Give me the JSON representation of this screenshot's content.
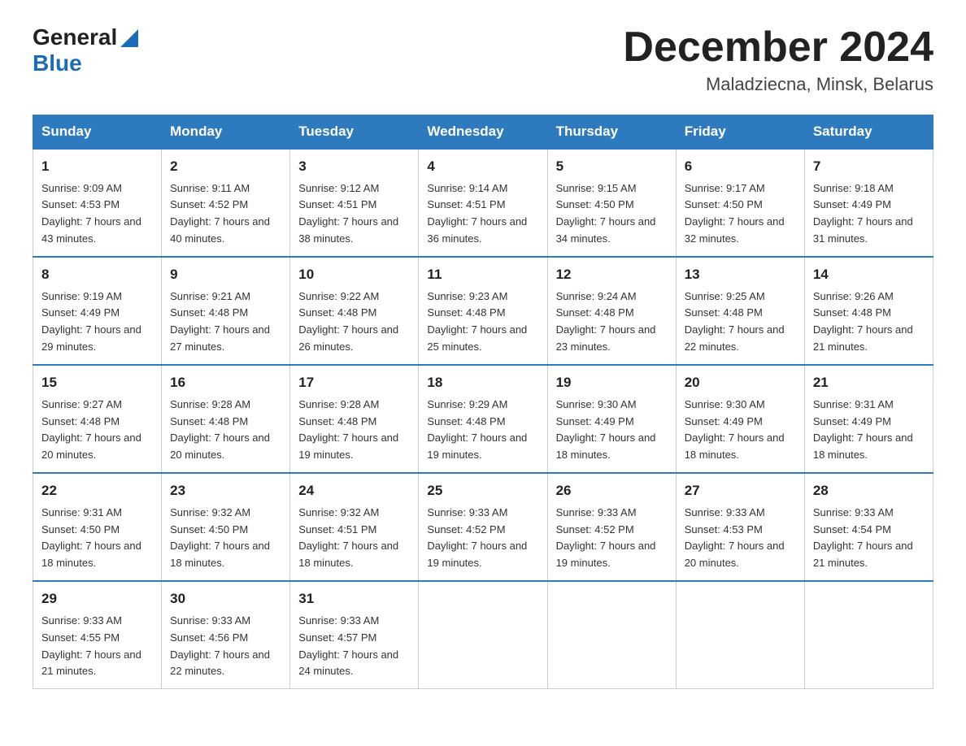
{
  "header": {
    "logo_general": "General",
    "logo_blue": "Blue",
    "month_title": "December 2024",
    "location": "Maladziecna, Minsk, Belarus"
  },
  "days_of_week": [
    "Sunday",
    "Monday",
    "Tuesday",
    "Wednesday",
    "Thursday",
    "Friday",
    "Saturday"
  ],
  "weeks": [
    [
      {
        "day": "1",
        "sunrise": "9:09 AM",
        "sunset": "4:53 PM",
        "daylight": "7 hours and 43 minutes."
      },
      {
        "day": "2",
        "sunrise": "9:11 AM",
        "sunset": "4:52 PM",
        "daylight": "7 hours and 40 minutes."
      },
      {
        "day": "3",
        "sunrise": "9:12 AM",
        "sunset": "4:51 PM",
        "daylight": "7 hours and 38 minutes."
      },
      {
        "day": "4",
        "sunrise": "9:14 AM",
        "sunset": "4:51 PM",
        "daylight": "7 hours and 36 minutes."
      },
      {
        "day": "5",
        "sunrise": "9:15 AM",
        "sunset": "4:50 PM",
        "daylight": "7 hours and 34 minutes."
      },
      {
        "day": "6",
        "sunrise": "9:17 AM",
        "sunset": "4:50 PM",
        "daylight": "7 hours and 32 minutes."
      },
      {
        "day": "7",
        "sunrise": "9:18 AM",
        "sunset": "4:49 PM",
        "daylight": "7 hours and 31 minutes."
      }
    ],
    [
      {
        "day": "8",
        "sunrise": "9:19 AM",
        "sunset": "4:49 PM",
        "daylight": "7 hours and 29 minutes."
      },
      {
        "day": "9",
        "sunrise": "9:21 AM",
        "sunset": "4:48 PM",
        "daylight": "7 hours and 27 minutes."
      },
      {
        "day": "10",
        "sunrise": "9:22 AM",
        "sunset": "4:48 PM",
        "daylight": "7 hours and 26 minutes."
      },
      {
        "day": "11",
        "sunrise": "9:23 AM",
        "sunset": "4:48 PM",
        "daylight": "7 hours and 25 minutes."
      },
      {
        "day": "12",
        "sunrise": "9:24 AM",
        "sunset": "4:48 PM",
        "daylight": "7 hours and 23 minutes."
      },
      {
        "day": "13",
        "sunrise": "9:25 AM",
        "sunset": "4:48 PM",
        "daylight": "7 hours and 22 minutes."
      },
      {
        "day": "14",
        "sunrise": "9:26 AM",
        "sunset": "4:48 PM",
        "daylight": "7 hours and 21 minutes."
      }
    ],
    [
      {
        "day": "15",
        "sunrise": "9:27 AM",
        "sunset": "4:48 PM",
        "daylight": "7 hours and 20 minutes."
      },
      {
        "day": "16",
        "sunrise": "9:28 AM",
        "sunset": "4:48 PM",
        "daylight": "7 hours and 20 minutes."
      },
      {
        "day": "17",
        "sunrise": "9:28 AM",
        "sunset": "4:48 PM",
        "daylight": "7 hours and 19 minutes."
      },
      {
        "day": "18",
        "sunrise": "9:29 AM",
        "sunset": "4:48 PM",
        "daylight": "7 hours and 19 minutes."
      },
      {
        "day": "19",
        "sunrise": "9:30 AM",
        "sunset": "4:49 PM",
        "daylight": "7 hours and 18 minutes."
      },
      {
        "day": "20",
        "sunrise": "9:30 AM",
        "sunset": "4:49 PM",
        "daylight": "7 hours and 18 minutes."
      },
      {
        "day": "21",
        "sunrise": "9:31 AM",
        "sunset": "4:49 PM",
        "daylight": "7 hours and 18 minutes."
      }
    ],
    [
      {
        "day": "22",
        "sunrise": "9:31 AM",
        "sunset": "4:50 PM",
        "daylight": "7 hours and 18 minutes."
      },
      {
        "day": "23",
        "sunrise": "9:32 AM",
        "sunset": "4:50 PM",
        "daylight": "7 hours and 18 minutes."
      },
      {
        "day": "24",
        "sunrise": "9:32 AM",
        "sunset": "4:51 PM",
        "daylight": "7 hours and 18 minutes."
      },
      {
        "day": "25",
        "sunrise": "9:33 AM",
        "sunset": "4:52 PM",
        "daylight": "7 hours and 19 minutes."
      },
      {
        "day": "26",
        "sunrise": "9:33 AM",
        "sunset": "4:52 PM",
        "daylight": "7 hours and 19 minutes."
      },
      {
        "day": "27",
        "sunrise": "9:33 AM",
        "sunset": "4:53 PM",
        "daylight": "7 hours and 20 minutes."
      },
      {
        "day": "28",
        "sunrise": "9:33 AM",
        "sunset": "4:54 PM",
        "daylight": "7 hours and 21 minutes."
      }
    ],
    [
      {
        "day": "29",
        "sunrise": "9:33 AM",
        "sunset": "4:55 PM",
        "daylight": "7 hours and 21 minutes."
      },
      {
        "day": "30",
        "sunrise": "9:33 AM",
        "sunset": "4:56 PM",
        "daylight": "7 hours and 22 minutes."
      },
      {
        "day": "31",
        "sunrise": "9:33 AM",
        "sunset": "4:57 PM",
        "daylight": "7 hours and 24 minutes."
      },
      null,
      null,
      null,
      null
    ]
  ],
  "labels": {
    "sunrise_prefix": "Sunrise: ",
    "sunset_prefix": "Sunset: ",
    "daylight_prefix": "Daylight: "
  }
}
